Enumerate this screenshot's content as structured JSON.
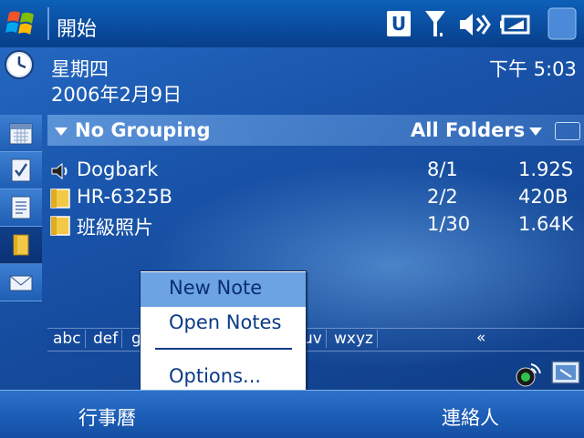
{
  "title_bar": {
    "title": "開始",
    "status_u": "U",
    "icons": [
      "windows-start-icon",
      "signal-icon",
      "speaker-icon",
      "battery-icon",
      "close-ok-icon"
    ]
  },
  "today": {
    "weekday": "星期四",
    "date": "2006年2月9日",
    "time": "下午 5:03"
  },
  "sidebar": {
    "items": [
      "calendar-icon",
      "tasks-icon",
      "notes-icon",
      "folder-icon",
      "mail-icon"
    ],
    "active": "folder-icon"
  },
  "list_header": {
    "grouping": "No Grouping",
    "folders": "All Folders"
  },
  "rows": [
    {
      "name": "Dogbark",
      "date": "8/1",
      "size": "1.92S",
      "icon": "sound-icon"
    },
    {
      "name": "HR-6325B",
      "date": "2/2",
      "size": "420B",
      "icon": "note-icon"
    },
    {
      "name": "班級照片",
      "date": "1/30",
      "size": "1.64K",
      "icon": "note-icon"
    }
  ],
  "alpha_bar": {
    "groups": [
      "abc",
      "def",
      "g",
      "uv",
      "wxyz"
    ],
    "more": "«"
  },
  "menu": {
    "items": [
      "New Note",
      "Open Notes",
      "Options..."
    ],
    "selected": "New Note"
  },
  "softkeys": {
    "left": "行事曆",
    "right": "連絡人"
  },
  "colors": {
    "title_bar": "#0a4da0",
    "desktop": "#1a56ad",
    "menu_highlight": "#6ba3e3"
  }
}
